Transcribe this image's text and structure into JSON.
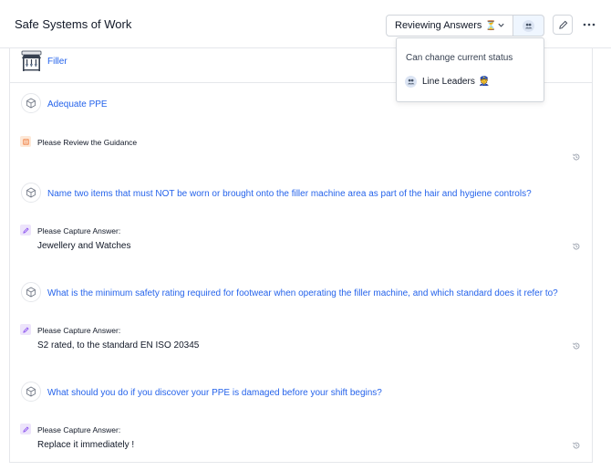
{
  "header": {
    "title": "Safe Systems of Work",
    "status_label": "Reviewing Answers",
    "status_emoji": "⏳"
  },
  "dropdown": {
    "heading": "Can change current status",
    "items": [
      {
        "label": "Line Leaders",
        "emoji": "👮"
      }
    ]
  },
  "section": {
    "label": "Filler"
  },
  "questions": [
    {
      "title": "Adequate PPE",
      "prompt": "Please Review the Guidance",
      "answer": ""
    },
    {
      "title": "Name two items that must NOT be worn or brought onto the filler machine area as part of the hair and hygiene controls?",
      "prompt": "Please Capture Answer:",
      "answer": "Jewellery and Watches"
    },
    {
      "title": "What is the minimum safety rating required for footwear when operating the filler machine, and which standard does it refer to?",
      "prompt": "Please Capture Answer:",
      "answer": "S2 rated, to the standard EN ISO 20345"
    },
    {
      "title": "What should you do if you discover your PPE is damaged before your shift begins?",
      "prompt": "Please Capture Answer:",
      "answer": "Replace it immediately !"
    }
  ],
  "colors": {
    "accent": "#2563eb",
    "border": "#e5e7eb",
    "guidance_badge": "#fde8d7",
    "answer_badge": "#ede4fb"
  },
  "icons": {
    "status_chevron": "chevron-down-icon",
    "assignees": "users-icon",
    "edit": "pencil-icon",
    "more": "more-horizontal-icon",
    "question": "cube-icon",
    "guidance": "document-icon",
    "answer": "pencil-icon",
    "history": "history-icon"
  }
}
